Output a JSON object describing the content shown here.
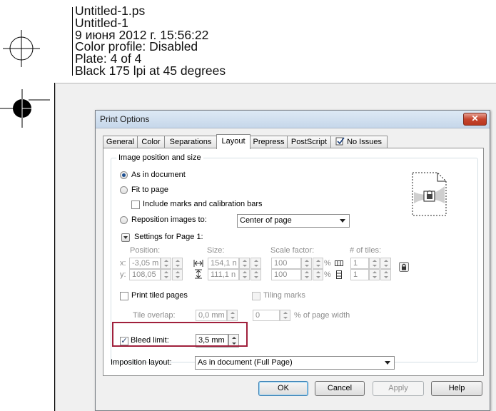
{
  "header": {
    "lines": [
      "Untitled-1.ps",
      "Untitled-1",
      "9 июня 2012 г. 15:56:22",
      "Color profile: Disabled",
      "Plate: 4 of 4",
      "Black  175 lpi at 45 degrees"
    ]
  },
  "dialog": {
    "title": "Print Options",
    "close_symbol": "✕",
    "tabs": [
      {
        "label": "General"
      },
      {
        "label": "Color"
      },
      {
        "label": "Separations"
      },
      {
        "label": "Layout"
      },
      {
        "label": "Prepress"
      },
      {
        "label": "PostScript"
      },
      {
        "label": "No Issues",
        "icon": "check-document-icon"
      }
    ],
    "active_tab": "Layout",
    "group_title": "Image position and size",
    "options": {
      "as_in_document": "As in document",
      "fit_to_page": "Fit to page",
      "include_marks": "Include marks and calibration bars",
      "reposition": "Reposition images to:",
      "reposition_value": "Center of page"
    },
    "settings_for_page": "Settings for Page 1:",
    "columns": {
      "position": "Position:",
      "size": "Size:",
      "scale": "Scale factor:",
      "tiles": "# of tiles:"
    },
    "axis_x": "x:",
    "axis_y": "y:",
    "position_x": "-3,05 m",
    "position_y": "108,05",
    "size_w": "154,1 n",
    "size_h": "111,1 n",
    "scale_w": "100",
    "scale_h": "100",
    "percent_symbol": "%",
    "tiles_x": "1",
    "tiles_y": "1",
    "print_tiled": "Print tiled pages",
    "tiling_marks": "Tiling marks",
    "tile_overlap_label": "Tile overlap:",
    "tile_overlap_value": "0,0 mm",
    "page_width_value": "0",
    "page_width_label": "% of page width",
    "bleed_limit_label": "Bleed limit:",
    "bleed_limit_checked": true,
    "bleed_limit_value": "3,5 mm",
    "imposition_label": "Imposition layout:",
    "imposition_value": "As in document (Full Page)",
    "buttons": {
      "ok": "OK",
      "cancel": "Cancel",
      "apply": "Apply",
      "help": "Help"
    }
  },
  "colors": {
    "highlight": "#a0203c",
    "radio_dot": "#1d4f91",
    "close_button": "#c6452e"
  }
}
